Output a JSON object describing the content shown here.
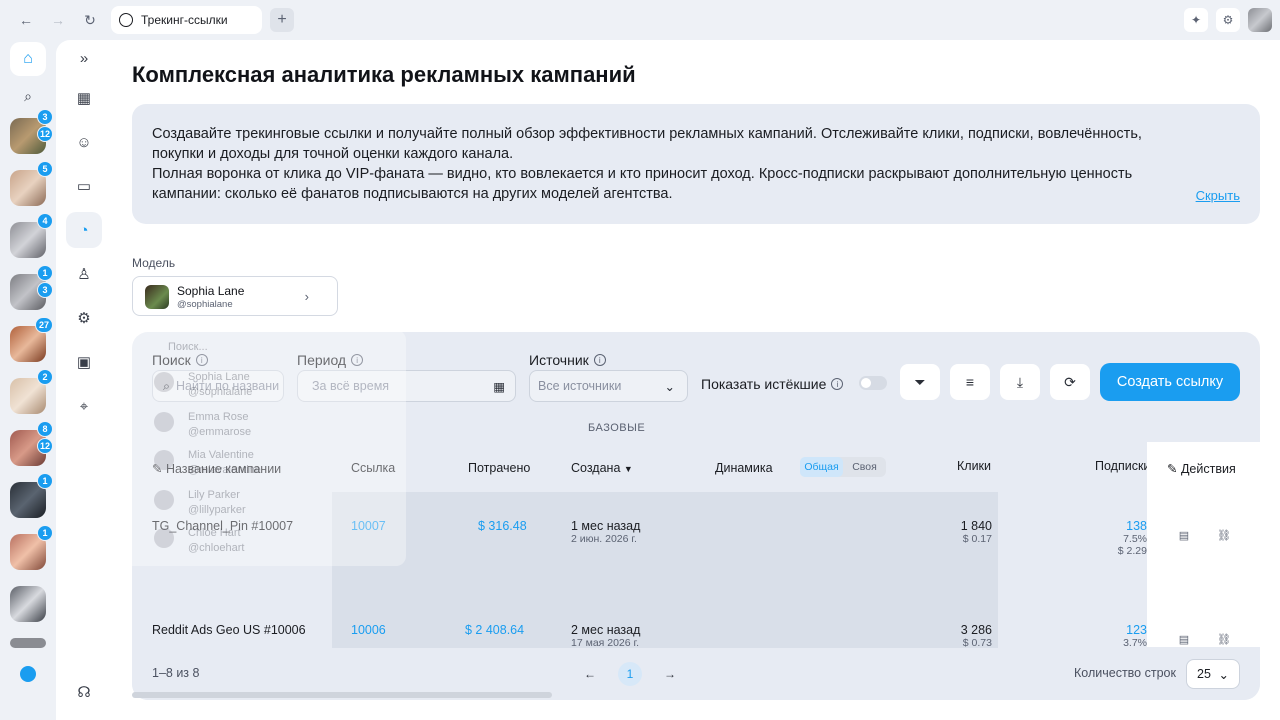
{
  "browser": {
    "tab_title": "Трекинг-ссылки",
    "new_tab": "+"
  },
  "rail": {
    "badges": [
      "3",
      "12",
      "5",
      "4",
      "1",
      "3",
      "27",
      "2",
      "8",
      "12",
      "1",
      "1"
    ]
  },
  "page": {
    "title": "Комплексная аналитика рекламных кампаний",
    "info_line1": "Создавайте трекинговые ссылки и получайте полный обзор эффективности рекламных кампаний. Отслеживайте клики, подписки, вовлечённость, покупки и доходы для точной оценки каждого канала.",
    "info_line2": "Полная воронка от клика до VIP-фаната — видно, кто вовлекается и кто приносит доход. Кросс-подписки раскрывают дополнительную ценность кампании: сколько её фанатов подписываются на других моделей агентства.",
    "hide_link": "Скрыть"
  },
  "model": {
    "label": "Модель",
    "name": "Sophia Lane",
    "handle": "@sophialane"
  },
  "ghost_dropdown": {
    "placeholder": "Поиск...",
    "items": [
      {
        "name": "Sophia Lane",
        "handle": "@sophialane"
      },
      {
        "name": "Emma Rose",
        "handle": "@emmarose"
      },
      {
        "name": "Mia Valentine",
        "handle": "@miavalentine"
      },
      {
        "name": "Lily Parker",
        "handle": "@lillyparker"
      },
      {
        "name": "Chloe Hart",
        "handle": "@chloehart"
      }
    ]
  },
  "filters": {
    "search_label": "Поиск",
    "search_placeholder": "Найти по названи",
    "period_label": "Период",
    "period_placeholder": "За всё время",
    "source_label": "Источник",
    "source_value": "Все источники",
    "show_expired": "Показать истёкшие",
    "create_button": "Создать ссылку"
  },
  "table": {
    "group_header": "БАЗОВЫЕ",
    "headers": {
      "campaign": "Название кампании",
      "link": "Ссылка",
      "spent": "Потрачено",
      "created": "Создана",
      "dynamics": "Динамика",
      "seg_general": "Общая",
      "seg_own": "Своя",
      "clicks": "Клики",
      "subs": "Подписки",
      "actions": "Действия"
    },
    "rows": [
      {
        "campaign": "TG_Channel_Pin #10007",
        "link": "10007",
        "spent": "$ 316.48",
        "created_rel": "1 мес назад",
        "created_date": "2 июн. 2026 г.",
        "clicks": "1 840",
        "clicks_cost": "$ 0.17",
        "subs": "138",
        "subs_pct": "7.5%",
        "subs_cost": "$ 2.29"
      },
      {
        "campaign": "Reddit Ads Geo US #10006",
        "link": "10006",
        "spent": "$ 2 408.64",
        "created_rel": "2 мес назад",
        "created_date": "17 мая 2026 г.",
        "clicks": "3 286",
        "clicks_cost": "$ 0.73",
        "subs": "123",
        "subs_pct": "3.7%"
      }
    ]
  },
  "pager": {
    "range": "1–8 из 8",
    "page": "1",
    "rows_label": "Количество строк",
    "rows_value": "25"
  }
}
